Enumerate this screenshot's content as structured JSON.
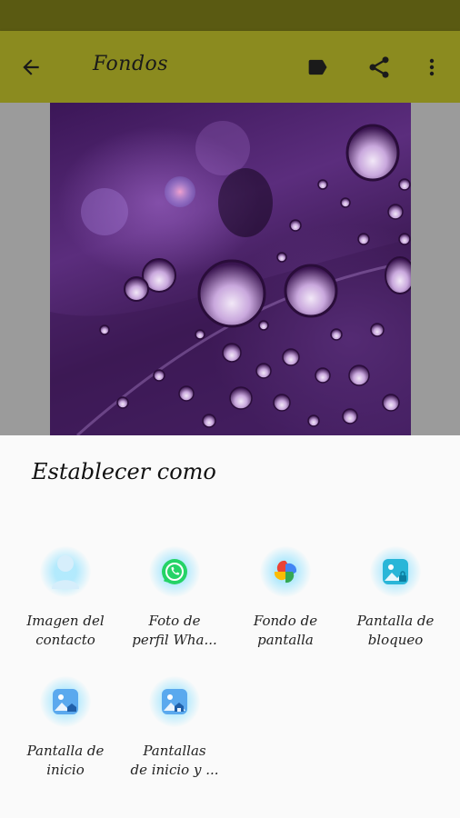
{
  "app_bar": {
    "title": "Fondos",
    "color": "#8b8b1f",
    "status_bar_color": "#5a5a12",
    "icons": [
      "back-arrow-icon",
      "label-icon",
      "share-icon",
      "more-vert-icon"
    ]
  },
  "share_sheet": {
    "title": "Establecer como",
    "targets": [
      {
        "line1": "Imagen del",
        "line2": "contacto",
        "icon": "contact-icon"
      },
      {
        "line1": "Foto de",
        "line2": "perfil Wha...",
        "icon": "whatsapp-icon"
      },
      {
        "line1": "Fondo de",
        "line2": "pantalla",
        "icon": "photos-pinwheel-icon"
      },
      {
        "line1": "Pantalla de",
        "line2": "bloqueo",
        "icon": "lock-screen-icon"
      },
      {
        "line1": "Pantalla de",
        "line2": "inicio",
        "icon": "home-screen-icon"
      },
      {
        "line1": "Pantallas",
        "line2": "de inicio y ...",
        "icon": "home-screens-icon"
      }
    ]
  }
}
